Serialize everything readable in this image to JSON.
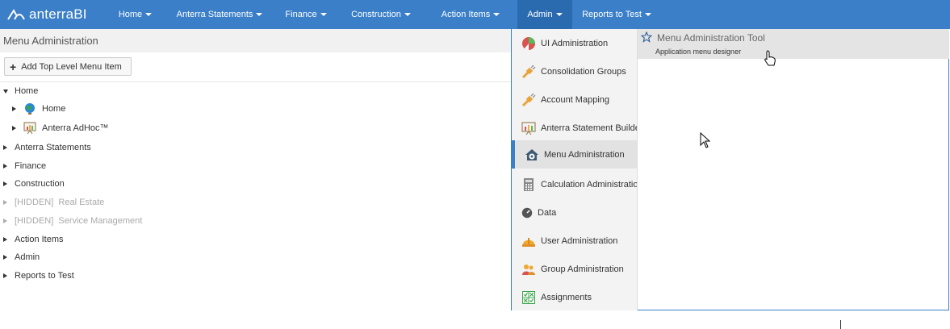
{
  "brand": {
    "name": "anterraBI"
  },
  "nav": [
    {
      "label": "Home",
      "active": false
    },
    {
      "label": "Anterra Statements",
      "active": false
    },
    {
      "label": "Finance",
      "active": false
    },
    {
      "label": "Construction",
      "active": false
    },
    {
      "label": "Action Items",
      "active": false
    },
    {
      "label": "Admin",
      "active": true
    },
    {
      "label": "Reports to Test",
      "active": false
    }
  ],
  "page": {
    "title": "Menu Administration"
  },
  "toolbar": {
    "add_label": "Add Top Level Menu Item"
  },
  "tree": [
    {
      "label": "Home",
      "level": 0,
      "expanded": true,
      "hidden": false
    },
    {
      "label": "Home",
      "level": 1,
      "expanded": false,
      "hidden": false,
      "icon": "globe-icon"
    },
    {
      "label": "Anterra AdHoc™",
      "level": 1,
      "expanded": false,
      "hidden": false,
      "icon": "presentation-board-icon"
    },
    {
      "label": "Anterra Statements",
      "level": 0,
      "expanded": false,
      "hidden": false
    },
    {
      "label": "Finance",
      "level": 0,
      "expanded": false,
      "hidden": false
    },
    {
      "label": "Construction",
      "level": 0,
      "expanded": false,
      "hidden": false
    },
    {
      "label": "[HIDDEN]  Real Estate",
      "level": 0,
      "expanded": false,
      "hidden": true
    },
    {
      "label": "[HIDDEN]  Service Management",
      "level": 0,
      "expanded": false,
      "hidden": true
    },
    {
      "label": "Action Items",
      "level": 0,
      "expanded": false,
      "hidden": false
    },
    {
      "label": "Admin",
      "level": 0,
      "expanded": false,
      "hidden": false
    },
    {
      "label": "Reports to Test",
      "level": 0,
      "expanded": false,
      "hidden": false
    }
  ],
  "admin_menu": {
    "items": [
      {
        "label": "UI Administration",
        "icon": "ui-admin-icon"
      },
      {
        "label": "Consolidation Groups",
        "icon": "plug-icon"
      },
      {
        "label": "Account Mapping",
        "icon": "plug-icon"
      },
      {
        "label": "Anterra Statement Builder",
        "icon": "presentation-board-icon"
      },
      {
        "label": "Menu Administration",
        "icon": "house-gear-icon",
        "active": true
      },
      {
        "label": "Calculation Administration",
        "icon": "calculator-icon"
      },
      {
        "label": "Data",
        "icon": "dashboard-gauge-icon"
      },
      {
        "label": "User Administration",
        "icon": "hard-hat-icon"
      },
      {
        "label": "Group Administration",
        "icon": "users-group-icon"
      },
      {
        "label": "Assignments",
        "icon": "assignment-grid-icon"
      }
    ],
    "submenu": {
      "title": "Menu Administration Tool",
      "description": "Application menu designer"
    }
  },
  "colors": {
    "navbar": "#3a7fc8",
    "navbar_active": "#2a6bb0",
    "hidden_text": "#aaaaaa"
  }
}
